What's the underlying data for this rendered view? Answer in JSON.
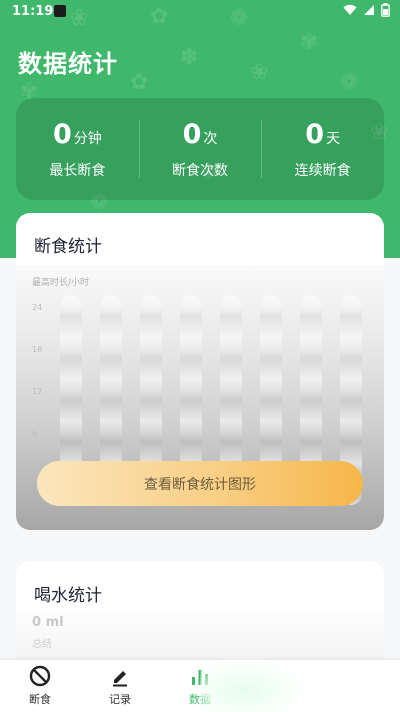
{
  "status": {
    "time": "11:19"
  },
  "page_title": "数据统计",
  "summary": [
    {
      "value": "0",
      "unit": "分钟",
      "label": "最长断食"
    },
    {
      "value": "0",
      "unit": "次",
      "label": "断食次数"
    },
    {
      "value": "0",
      "unit": "天",
      "label": "连续断食"
    }
  ],
  "fasting_stats": {
    "title": "断食统计",
    "legend": "最高时长/小时",
    "y_ticks": [
      "24",
      "18",
      "12",
      "6"
    ],
    "button_label": "查看断食统计图形"
  },
  "water_stats": {
    "title": "喝水统计",
    "value": "0 ml",
    "sub": "总结"
  },
  "tabs": [
    {
      "label": "断食",
      "icon": "no-entry-icon"
    },
    {
      "label": "记录",
      "icon": "pencil-icon"
    },
    {
      "label": "数据",
      "icon": "bar-chart-icon"
    }
  ],
  "colors": {
    "primary_green": "#3fb86b",
    "button_orange": "#f7b64a"
  }
}
